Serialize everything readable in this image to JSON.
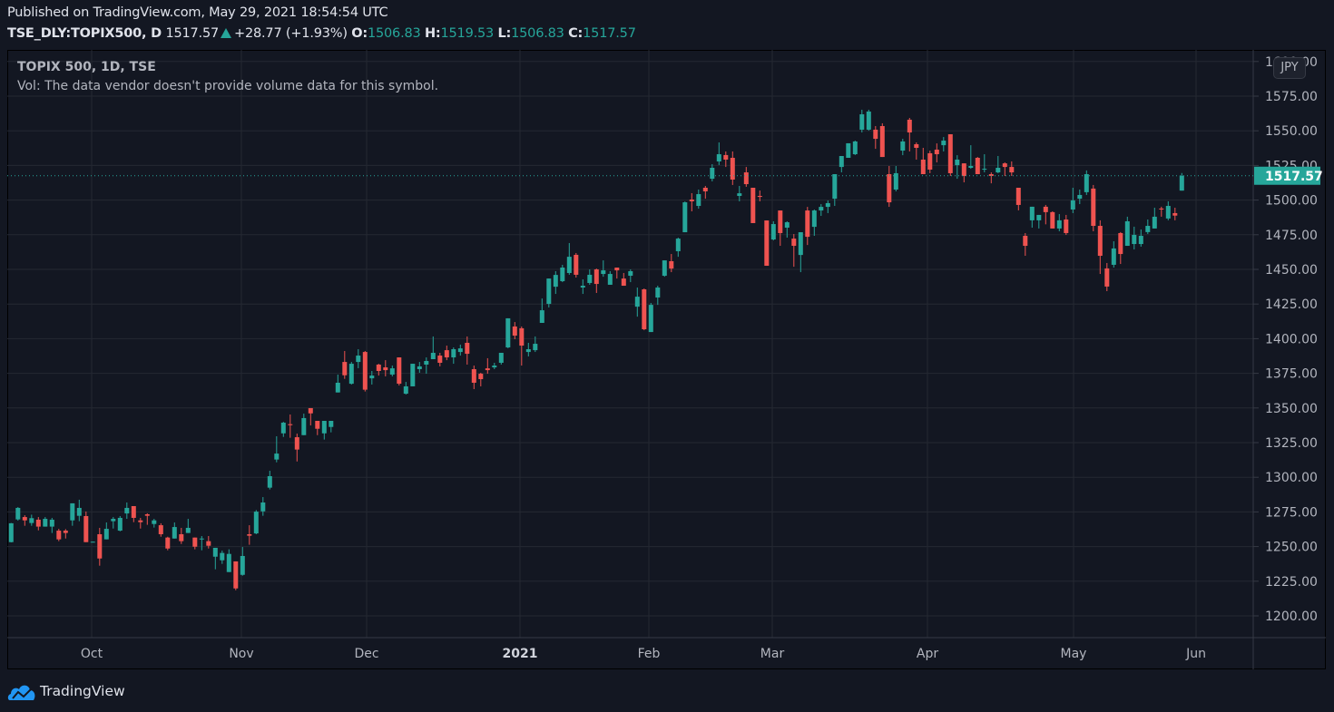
{
  "header": {
    "published": "Published on TradingView.com, May 29, 2021 18:54:54 UTC",
    "symbol": "TSE_DLY:TOPIX500, D",
    "last": "1517.57",
    "change": "+28.77 (+1.93%)",
    "o_label": "O:",
    "o": "1506.83",
    "h_label": "H:",
    "h": "1519.53",
    "l_label": "L:",
    "l": "1506.83",
    "c_label": "C:",
    "c": "1517.57"
  },
  "legend": {
    "title": "TOPIX 500, 1D, TSE",
    "volume_note": "Vol: The data vendor doesn't provide volume data for this symbol."
  },
  "currency_badge": "JPY",
  "last_price_label": "1517.57",
  "footer": {
    "brand": "TradingView"
  },
  "colors": {
    "up": "#26a69a",
    "down": "#ef5350",
    "background": "#131722",
    "grid": "#242832",
    "brand": "#2196f3"
  },
  "chart_data": {
    "type": "candlestick",
    "title": "TOPIX 500, 1D, TSE",
    "ylim": [
      1185,
      1605
    ],
    "price_ticks": [
      "1200.00",
      "1225.00",
      "1250.00",
      "1275.00",
      "1300.00",
      "1325.00",
      "1350.00",
      "1375.00",
      "1400.00",
      "1425.00",
      "1450.00",
      "1475.00",
      "1500.00",
      "1525.00",
      "1550.00",
      "1575.00",
      "1600.00"
    ],
    "time_ticks": [
      "Oct",
      "Nov",
      "Dec",
      "2021",
      "Feb",
      "Mar",
      "Apr",
      "May",
      "Jun"
    ],
    "last_price": 1517.57,
    "grid": true,
    "ohlc_fields": [
      "open",
      "high",
      "low",
      "close"
    ],
    "candles": [
      [
        1253.2,
        1267,
        1253,
        1266.8
      ],
      [
        1269.6,
        1278.5,
        1268.7,
        1277.9
      ],
      [
        1271.3,
        1272.6,
        1265,
        1268.9
      ],
      [
        1267,
        1273,
        1265,
        1270.5
      ],
      [
        1269.4,
        1271.3,
        1261.7,
        1264.4
      ],
      [
        1264.4,
        1271.3,
        1264.4,
        1270
      ],
      [
        1264.4,
        1270.7,
        1259.8,
        1269.4
      ],
      [
        1261.5,
        1262.8,
        1253.9,
        1255.2
      ],
      [
        1261.5,
        1262.6,
        1255.8,
        1259.8
      ],
      [
        1268.9,
        1281.2,
        1265,
        1281.2
      ],
      [
        1272.2,
        1283.8,
        1268.3,
        1277.9
      ],
      [
        1272,
        1275.3,
        1253.2,
        1253.2
      ],
      [
        1253.4,
        1253.6,
        1253.2,
        1253.5
      ],
      [
        1258.9,
        1263.5,
        1236.2,
        1241.4
      ],
      [
        1255.2,
        1267.4,
        1255.2,
        1262.8
      ],
      [
        1268.3,
        1271.3,
        1263,
        1270
      ],
      [
        1261.5,
        1272,
        1261,
        1270.7
      ],
      [
        1273.9,
        1281.8,
        1270,
        1277.9
      ],
      [
        1279.2,
        1279.2,
        1267.6,
        1270.7
      ],
      [
        1268.9,
        1270.7,
        1263,
        1267.6
      ],
      [
        1273.3,
        1274,
        1265.7,
        1272.2
      ],
      [
        1266.3,
        1270,
        1263.7,
        1268.9
      ],
      [
        1265.4,
        1266.8,
        1257.1,
        1258.9
      ],
      [
        1256.5,
        1257.1,
        1247.3,
        1248.6
      ],
      [
        1255.8,
        1267.4,
        1255.8,
        1264.1
      ],
      [
        1258.9,
        1263.5,
        1251.9,
        1253.9
      ],
      [
        1259.8,
        1270,
        1259.8,
        1263.5
      ],
      [
        1256.5,
        1256.5,
        1248,
        1249.9
      ],
      [
        1255.2,
        1257.6,
        1247.3,
        1255.8
      ],
      [
        1253.9,
        1257.6,
        1248.6,
        1250.6
      ],
      [
        1242.7,
        1249.1,
        1233.6,
        1249.1
      ],
      [
        1240.1,
        1247.1,
        1237.5,
        1245.4
      ],
      [
        1231.6,
        1248,
        1231.6,
        1244.7
      ],
      [
        1239.3,
        1239.3,
        1218.5,
        1219.8
      ],
      [
        1229.6,
        1249.7,
        1229,
        1243.2
      ],
      [
        1258.9,
        1265.4,
        1251.3,
        1257.8
      ],
      [
        1259.5,
        1276.3,
        1258.9,
        1275.2
      ],
      [
        1275.4,
        1285.7,
        1272.2,
        1281.8
      ],
      [
        1292.5,
        1304.7,
        1291.2,
        1300.8
      ],
      [
        1312.8,
        1329.6,
        1310.8,
        1317.1
      ],
      [
        1331.7,
        1340,
        1329.1,
        1339.4
      ],
      [
        1338.3,
        1345.3,
        1328.5,
        1337.6
      ],
      [
        1328.9,
        1331.5,
        1311.4,
        1320
      ],
      [
        1330.4,
        1345.9,
        1330.4,
        1342.7
      ],
      [
        1349.9,
        1349.9,
        1337.4,
        1346.1
      ],
      [
        1340.7,
        1340.7,
        1330.4,
        1335
      ],
      [
        1331.7,
        1340.7,
        1327.2,
        1340.7
      ],
      [
        1336.3,
        1340.7,
        1332.4,
        1340.7
      ],
      [
        1361.2,
        1374.1,
        1361.2,
        1368.2
      ],
      [
        1383.2,
        1391.1,
        1371,
        1373.6
      ],
      [
        1367.5,
        1383.2,
        1366.9,
        1381.9
      ],
      [
        1383.2,
        1392.4,
        1378.7,
        1387.8
      ],
      [
        1390.4,
        1391.1,
        1361.9,
        1363.2
      ],
      [
        1371.4,
        1376.7,
        1366.9,
        1373.4
      ],
      [
        1381.3,
        1381.9,
        1373.4,
        1376.7
      ],
      [
        1379.3,
        1384.5,
        1372.8,
        1377.3
      ],
      [
        1374.1,
        1380.6,
        1372.8,
        1378.6
      ],
      [
        1386.5,
        1386.5,
        1366.2,
        1367.5
      ],
      [
        1360.3,
        1368.8,
        1359.7,
        1365.6
      ],
      [
        1365.6,
        1381.9,
        1365.6,
        1381.9
      ],
      [
        1378,
        1383.2,
        1375.4,
        1380
      ],
      [
        1381.3,
        1386.5,
        1374.7,
        1383.9
      ],
      [
        1385.2,
        1401.6,
        1385.2,
        1389.8
      ],
      [
        1387.8,
        1389.8,
        1380,
        1382.6
      ],
      [
        1391.7,
        1395,
        1384.5,
        1386.5
      ],
      [
        1386.5,
        1393.7,
        1381.9,
        1392.4
      ],
      [
        1390.4,
        1395.7,
        1387.8,
        1393
      ],
      [
        1397,
        1401.6,
        1381.3,
        1389.1
      ],
      [
        1378,
        1380.6,
        1363.6,
        1368.2
      ],
      [
        1374.7,
        1375.4,
        1365.6,
        1370.8
      ],
      [
        1378.6,
        1385.9,
        1374.7,
        1377.3
      ],
      [
        1379.3,
        1382.6,
        1378,
        1380.6
      ],
      [
        1382.6,
        1389.8,
        1381.3,
        1389.8
      ],
      [
        1393.7,
        1414.7,
        1393.1,
        1414.7
      ],
      [
        1408.8,
        1412,
        1399.6,
        1402.2
      ],
      [
        1407.5,
        1408.8,
        1380.6,
        1395
      ],
      [
        1390.4,
        1397,
        1387.2,
        1392.4
      ],
      [
        1391.7,
        1401.6,
        1390.4,
        1396.3
      ],
      [
        1411.4,
        1429,
        1411.4,
        1420.5
      ],
      [
        1425.1,
        1443.4,
        1422.5,
        1443.4
      ],
      [
        1437.5,
        1448.7,
        1432.3,
        1446
      ],
      [
        1441.5,
        1453.3,
        1440.8,
        1451.3
      ],
      [
        1447.4,
        1469,
        1446.1,
        1459.1
      ],
      [
        1460.5,
        1461.8,
        1444.1,
        1446.1
      ],
      [
        1436.9,
        1442.8,
        1432.3,
        1438.2
      ],
      [
        1440.2,
        1450,
        1438.9,
        1446.1
      ],
      [
        1450,
        1450.6,
        1433,
        1439.5
      ],
      [
        1446.7,
        1456.5,
        1444.7,
        1449.3
      ],
      [
        1438.9,
        1448.7,
        1438.9,
        1446.7
      ],
      [
        1451.3,
        1451.3,
        1443.4,
        1449.3
      ],
      [
        1443.4,
        1447.4,
        1438.2,
        1438.2
      ],
      [
        1445.4,
        1450,
        1440.8,
        1448.7
      ],
      [
        1423.1,
        1436.9,
        1415.9,
        1430.3
      ],
      [
        1435.6,
        1436.2,
        1406.1,
        1406.8
      ],
      [
        1404.8,
        1425.8,
        1404.8,
        1424.4
      ],
      [
        1429.7,
        1438.2,
        1424.4,
        1436.9
      ],
      [
        1445.4,
        1456.5,
        1444.7,
        1456.5
      ],
      [
        1455.9,
        1461.1,
        1448,
        1450.6
      ],
      [
        1463.1,
        1472.9,
        1459.1,
        1472.2
      ],
      [
        1476.8,
        1499,
        1476.8,
        1498.4
      ],
      [
        1500.4,
        1505,
        1491.9,
        1499.1
      ],
      [
        1495.8,
        1507.6,
        1493.8,
        1504.3
      ],
      [
        1508.9,
        1510.2,
        1501,
        1506.3
      ],
      [
        1515.4,
        1525.9,
        1513.5,
        1523.3
      ],
      [
        1527.9,
        1541.6,
        1525.3,
        1533.1
      ],
      [
        1532.5,
        1535.1,
        1523.9,
        1529.2
      ],
      [
        1530.5,
        1535.1,
        1510.9,
        1514.8
      ],
      [
        1503,
        1510.2,
        1499.1,
        1504.9
      ],
      [
        1520,
        1523.9,
        1509.6,
        1511.5
      ],
      [
        1508.9,
        1508.9,
        1483.4,
        1483.4
      ],
      [
        1503,
        1506.9,
        1499.1,
        1502.3
      ],
      [
        1485.3,
        1485.3,
        1452.6,
        1452.6
      ],
      [
        1471.6,
        1484.7,
        1470.9,
        1482.7
      ],
      [
        1492.5,
        1492.5,
        1467,
        1476.2
      ],
      [
        1480.1,
        1484.7,
        1472.9,
        1484
      ],
      [
        1472.2,
        1475.5,
        1451.9,
        1467
      ],
      [
        1460.4,
        1476.8,
        1448,
        1476.8
      ],
      [
        1492.5,
        1495.1,
        1467.6,
        1473.5
      ],
      [
        1480.7,
        1493.2,
        1474.2,
        1492.5
      ],
      [
        1492.5,
        1497.1,
        1488.6,
        1495.1
      ],
      [
        1495.1,
        1499.7,
        1490.6,
        1497.8
      ],
      [
        1501,
        1518.7,
        1495.8,
        1518.7
      ],
      [
        1523.9,
        1531.8,
        1520,
        1531.8
      ],
      [
        1530.5,
        1541,
        1530.5,
        1541
      ],
      [
        1533.1,
        1542.9,
        1532.5,
        1542.3
      ],
      [
        1550.8,
        1565.2,
        1548.8,
        1561.9
      ],
      [
        1550.8,
        1565.2,
        1550.1,
        1563.9
      ],
      [
        1550.8,
        1553.4,
        1537,
        1544.2
      ],
      [
        1553.4,
        1555.4,
        1531.1,
        1531.1
      ],
      [
        1518.7,
        1524.6,
        1495.1,
        1498.4
      ],
      [
        1507.6,
        1524.6,
        1506.3,
        1519.4
      ],
      [
        1535.7,
        1544.2,
        1532.4,
        1542.3
      ],
      [
        1558,
        1559.3,
        1535.1,
        1548.8
      ],
      [
        1540.3,
        1541.6,
        1529.2,
        1537.7
      ],
      [
        1529.2,
        1537.7,
        1518.7,
        1518.7
      ],
      [
        1533.8,
        1535.7,
        1519.4,
        1522
      ],
      [
        1536.4,
        1540.9,
        1527.2,
        1533.1
      ],
      [
        1539.6,
        1545.5,
        1535.1,
        1542.9
      ],
      [
        1547.5,
        1547.5,
        1517.4,
        1519.4
      ],
      [
        1525.2,
        1532.4,
        1515.4,
        1529.2
      ],
      [
        1526.5,
        1526.5,
        1512.8,
        1517.4
      ],
      [
        1523.3,
        1539.6,
        1522.6,
        1524.6
      ],
      [
        1530.5,
        1531.1,
        1518.7,
        1518.7
      ],
      [
        1522,
        1533.1,
        1520,
        1522.6
      ],
      [
        1518.7,
        1520,
        1512.1,
        1517.4
      ],
      [
        1520,
        1531.8,
        1519.4,
        1523.3
      ],
      [
        1526.5,
        1527.2,
        1517.4,
        1523.9
      ],
      [
        1523.9,
        1527.9,
        1517.4,
        1520
      ],
      [
        1508.9,
        1508.9,
        1492.6,
        1496.5
      ],
      [
        1474.2,
        1476.2,
        1459.8,
        1467
      ],
      [
        1485.4,
        1495.2,
        1480.1,
        1495.2
      ],
      [
        1485.4,
        1489.3,
        1479.5,
        1489.3
      ],
      [
        1495.2,
        1496.5,
        1482.5,
        1491.3
      ],
      [
        1491.3,
        1491.9,
        1479.5,
        1479.5
      ],
      [
        1479.5,
        1489.9,
        1477.5,
        1485.4
      ],
      [
        1486,
        1489.3,
        1474.9,
        1476.2
      ],
      [
        1493.2,
        1508.9,
        1490.6,
        1499.8
      ],
      [
        1501,
        1507.6,
        1497.1,
        1503.7
      ],
      [
        1505.7,
        1521.4,
        1503.7,
        1518.7
      ],
      [
        1508.3,
        1510.9,
        1477.5,
        1481.4
      ],
      [
        1481.4,
        1485.4,
        1446.7,
        1459.8
      ],
      [
        1450.7,
        1454.6,
        1434.3,
        1437.6
      ],
      [
        1453.3,
        1470.3,
        1451.3,
        1465.1
      ],
      [
        1476.2,
        1476.9,
        1453.9,
        1461.1
      ],
      [
        1467,
        1488,
        1467,
        1484.7
      ],
      [
        1468.3,
        1480.8,
        1464.4,
        1474.9
      ],
      [
        1468.3,
        1478.8,
        1466.4,
        1474.2
      ],
      [
        1476.9,
        1486,
        1475.5,
        1481.4
      ],
      [
        1479.5,
        1494.5,
        1479.5,
        1488
      ],
      [
        1493.9,
        1495.2,
        1488,
        1493.2
      ],
      [
        1486.7,
        1499.1,
        1485.4,
        1495.8
      ],
      [
        1490.6,
        1494.5,
        1485.4,
        1488.8
      ],
      [
        1506.83,
        1519.53,
        1506.83,
        1517.57
      ]
    ]
  }
}
